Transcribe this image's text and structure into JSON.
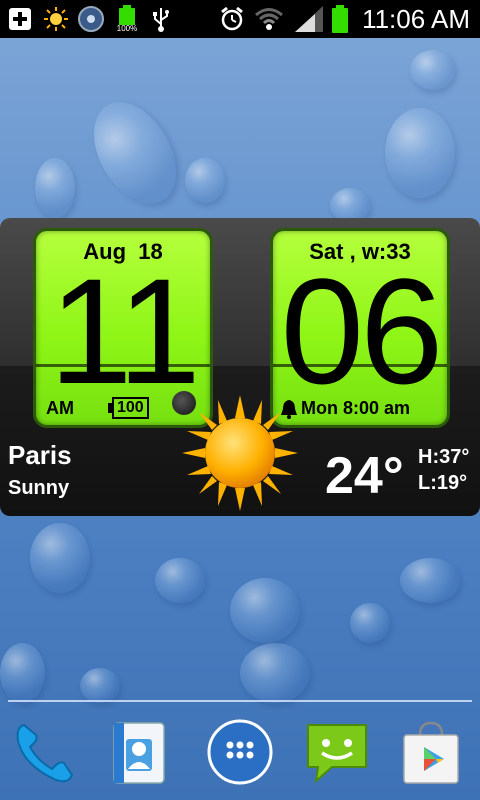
{
  "statusbar": {
    "battery_small_label": "100%",
    "time": "11:06 AM",
    "icons": [
      "plus-notification-icon",
      "sun-notification-icon",
      "media-icon",
      "battery-full-icon",
      "usb-icon",
      "alarm-icon",
      "wifi-icon",
      "signal-icon",
      "battery-icon"
    ]
  },
  "widget": {
    "date": "Aug  18",
    "hour": "11",
    "ampm": "AM",
    "battery_level": "100",
    "day_week": "Sat , w:33",
    "minute": "06",
    "alarm": "Mon 8:00 am",
    "city": "Paris",
    "condition": "Sunny",
    "temperature": "24°",
    "high": "H:37°",
    "low": "L:19°",
    "weather_icon": "sun-icon"
  },
  "dock": {
    "items": [
      "phone-icon",
      "contacts-icon",
      "app-drawer-icon",
      "messaging-icon",
      "play-store-icon"
    ]
  },
  "colors": {
    "panel_green": "#8ef516",
    "status_bar": "#000000",
    "battery_green": "#33dd00"
  }
}
